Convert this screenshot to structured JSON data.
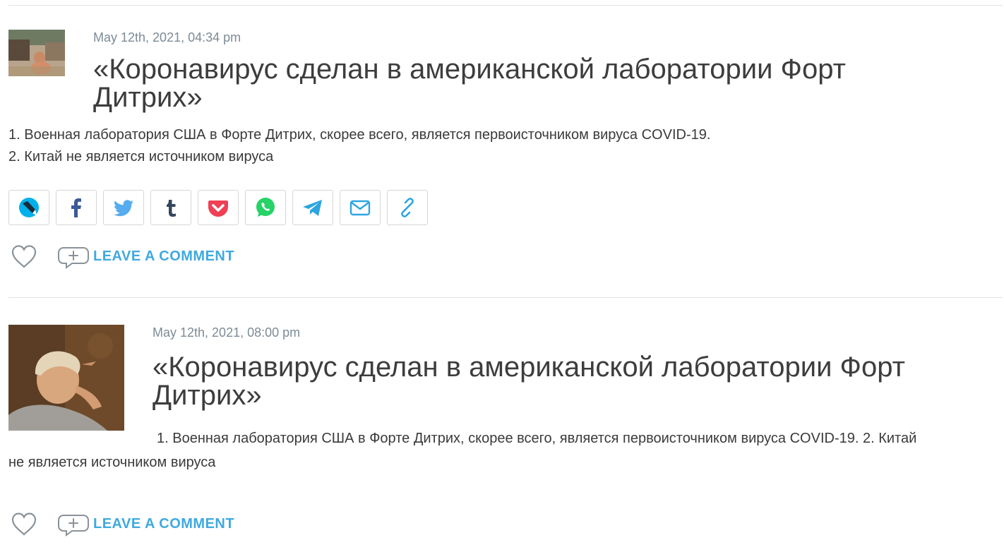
{
  "posts": [
    {
      "date": "May 12th, 2021, 04:34 pm",
      "title": "«Коронавирус сделан в американской лаборатории Форт Дитрих»",
      "body_line1": "1. Военная лаборатория США в Форте Дитрих, скорее всего, является первоисточником вируса COVID-19.",
      "body_line2": "2. Китай не является источником вируса",
      "comment_label": "LEAVE A COMMENT",
      "avatar_icon": "avatar-photo-icon"
    },
    {
      "date": "May 12th, 2021, 08:00 pm",
      "title": "«Коронавирус сделан в американской лаборатории Форт Дитрих»",
      "body": "1. Военная лаборатория США в Форте Дитрих, скорее всего, является первоисточником вируса COVID-19. 2. Китай не является источником вируса",
      "comment_label": "LEAVE A COMMENT",
      "avatar_icon": "avatar-photo-icon"
    }
  ],
  "share_icons": [
    "livejournal-icon",
    "facebook-icon",
    "twitter-icon",
    "tumblr-icon",
    "pocket-icon",
    "whatsapp-icon",
    "telegram-icon",
    "email-icon",
    "link-icon"
  ],
  "colors": {
    "accent": "#3fa9e0",
    "facebook": "#3b5998",
    "twitter": "#55acee",
    "tumblr": "#35465c",
    "pocket": "#ef4056",
    "whatsapp": "#25d366",
    "telegram": "#2ca5e0",
    "divider": "#e3e3e3"
  }
}
